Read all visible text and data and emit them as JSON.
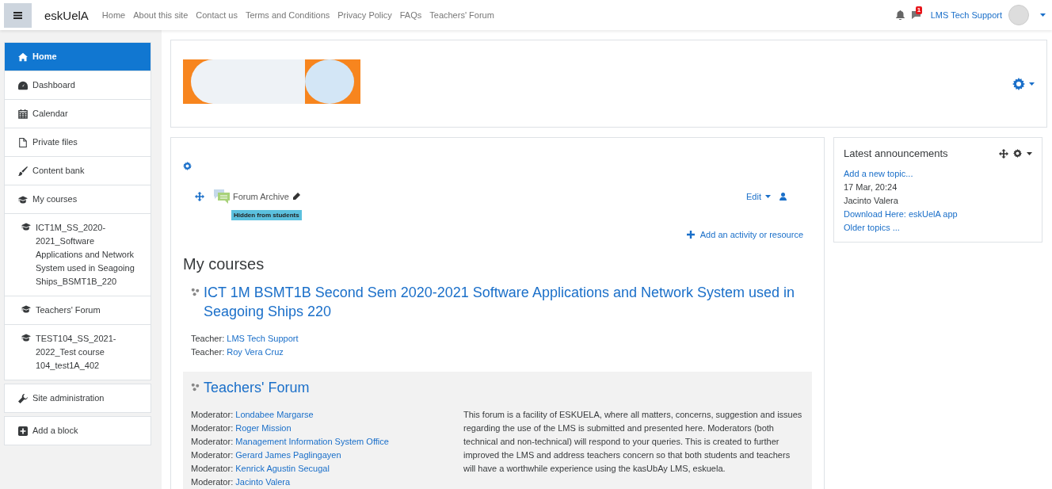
{
  "navbar": {
    "brand": "eskUelA",
    "links": [
      "Home",
      "About this site",
      "Contact us",
      "Terms and Conditions",
      "Privacy Policy",
      "FAQs",
      "Teachers' Forum"
    ],
    "message_count": "1",
    "user_name": "LMS Tech Support"
  },
  "sidebar": {
    "groups": [
      [
        {
          "label": "Home",
          "kind": "home",
          "selected": true
        },
        {
          "label": "Dashboard",
          "kind": "dashboard",
          "selected": false
        },
        {
          "label": "Calendar",
          "kind": "calendar",
          "selected": false
        },
        {
          "label": "Private files",
          "kind": "files",
          "selected": false
        },
        {
          "label": "Content bank",
          "kind": "content",
          "selected": false
        },
        {
          "label": "My courses",
          "kind": "courses",
          "selected": false
        },
        {
          "label": "ICT1M_SS_2020-2021_Software Applications and Network System used in Seagoing Ships_BSMT1B_220",
          "kind": "course",
          "selected": false
        },
        {
          "label": "Teachers' Forum",
          "kind": "course",
          "selected": false
        },
        {
          "label": "TEST104_SS_2021-2022_Test course 104_test1A_402",
          "kind": "course",
          "selected": false
        }
      ],
      [
        {
          "label": "Site administration",
          "kind": "admin",
          "selected": false
        }
      ],
      [
        {
          "label": "Add a block",
          "kind": "block",
          "selected": false
        }
      ]
    ]
  },
  "activity": {
    "name": "Forum Archive",
    "badge": "Hidden from students",
    "edit": "Edit"
  },
  "add_activity": "Add an activity or resource",
  "my_courses": {
    "heading": "My courses",
    "courses": [
      {
        "title": "ICT 1M BSMT1B Second Sem 2020-2021 Software Applications and Network System used in Seagoing Ships 220",
        "highlighted": false,
        "contacts": [
          {
            "role": "Teacher:",
            "name": "LMS Tech Support"
          },
          {
            "role": "Teacher:",
            "name": "Roy Vera Cruz"
          }
        ]
      },
      {
        "title": "Teachers' Forum",
        "highlighted": true,
        "contacts": [
          {
            "role": "Moderator:",
            "name": "Londabee Margarse"
          },
          {
            "role": "Moderator:",
            "name": "Roger Mission"
          },
          {
            "role": "Moderator:",
            "name": "Management Information System Office"
          },
          {
            "role": "Moderator:",
            "name": "Gerard James Paglingayen"
          },
          {
            "role": "Moderator:",
            "name": "Kenrick Agustin Secugal"
          },
          {
            "role": "Moderator:",
            "name": "Jacinto Valera"
          }
        ],
        "summary": "This forum is a facility of ESKUELA, where all matters, concerns, suggestion and issues regarding the use of the LMS is submitted and presented here.  Moderators (both technical and non-technical) will respond to your queries. This is created to further improved the LMS and address teachers concern so that both students and teachers will have a worthwhile experience using the kasUbAy LMS, eskuela."
      }
    ]
  },
  "announcements": {
    "title": "Latest announcements",
    "add_topic": "Add a new topic...",
    "posts": [
      {
        "date": "17 Mar, 20:24",
        "author": "Jacinto Valera",
        "subject": "Download Here: eskUelA app"
      }
    ],
    "older": "Older topics ..."
  }
}
